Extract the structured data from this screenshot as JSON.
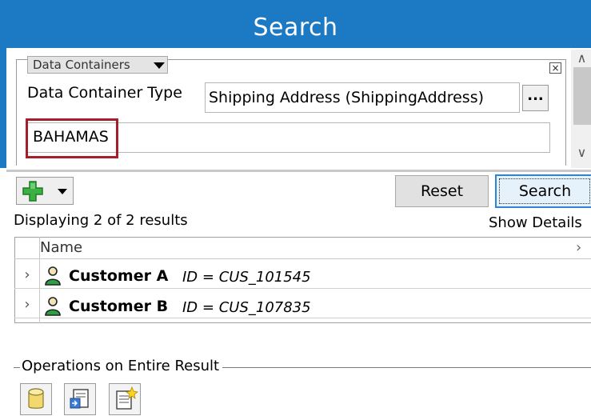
{
  "window": {
    "title": "Search"
  },
  "criteria": {
    "containers_dropdown_label": "Data Containers",
    "close_glyph": "×",
    "type_label": "Data Container Type",
    "type_value": "Shipping Address (ShippingAddress)",
    "browse_label": "...",
    "search_value": "BAHAMAS",
    "highlight_color": "#a31f2b"
  },
  "toolbar": {
    "add_icon": "green-plus-icon",
    "reset_label": "Reset",
    "search_label": "Search"
  },
  "results": {
    "count_text": "Displaying 2 of 2 results",
    "show_details_label": "Show Details",
    "columns": [
      "Name"
    ],
    "rows": [
      {
        "name": "Customer A",
        "id_text": "ID = CUS_101545",
        "icon": "customer-person-icon"
      },
      {
        "name": "Customer B",
        "id_text": "ID = CUS_107835",
        "icon": "customer-person-icon"
      }
    ]
  },
  "operations": {
    "label": "Operations on Entire Result",
    "buttons": [
      {
        "icon": "database-icon"
      },
      {
        "icon": "export-document-icon"
      },
      {
        "icon": "new-document-icon"
      }
    ]
  },
  "colors": {
    "title_bar": "#1c79c4",
    "accent_blue": "#2f83d4",
    "icon_green": "#3cb043"
  }
}
